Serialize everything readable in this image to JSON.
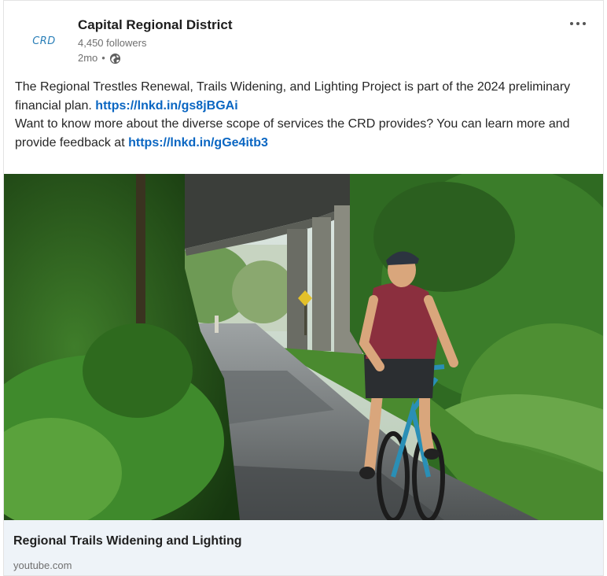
{
  "post": {
    "author": {
      "name": "Capital Regional District",
      "logo_text": "CRD",
      "followers": "4,450 followers",
      "age": "2mo",
      "separator": "•",
      "visibility_icon": "globe-icon"
    },
    "menu_icon": "more-horizontal-icon",
    "text": {
      "line1": "The Regional Trestles Renewal, Trails Widening, and Lighting Project is part of the 2024 preliminary financial plan.",
      "link1": "https://lnkd.in/gs8jBGAi",
      "line2": "Want to know more about the diverse scope of services the CRD provides? You can learn more and provide feedback at",
      "link2": "https://lnkd.in/gGe4itb3"
    },
    "link_preview": {
      "title": "Regional Trails Widening and Lighting",
      "domain": "youtube.com"
    }
  },
  "colors": {
    "link": "#0a66c2",
    "logo": "#2a7fb8",
    "preview_bg": "#eef3f8"
  }
}
